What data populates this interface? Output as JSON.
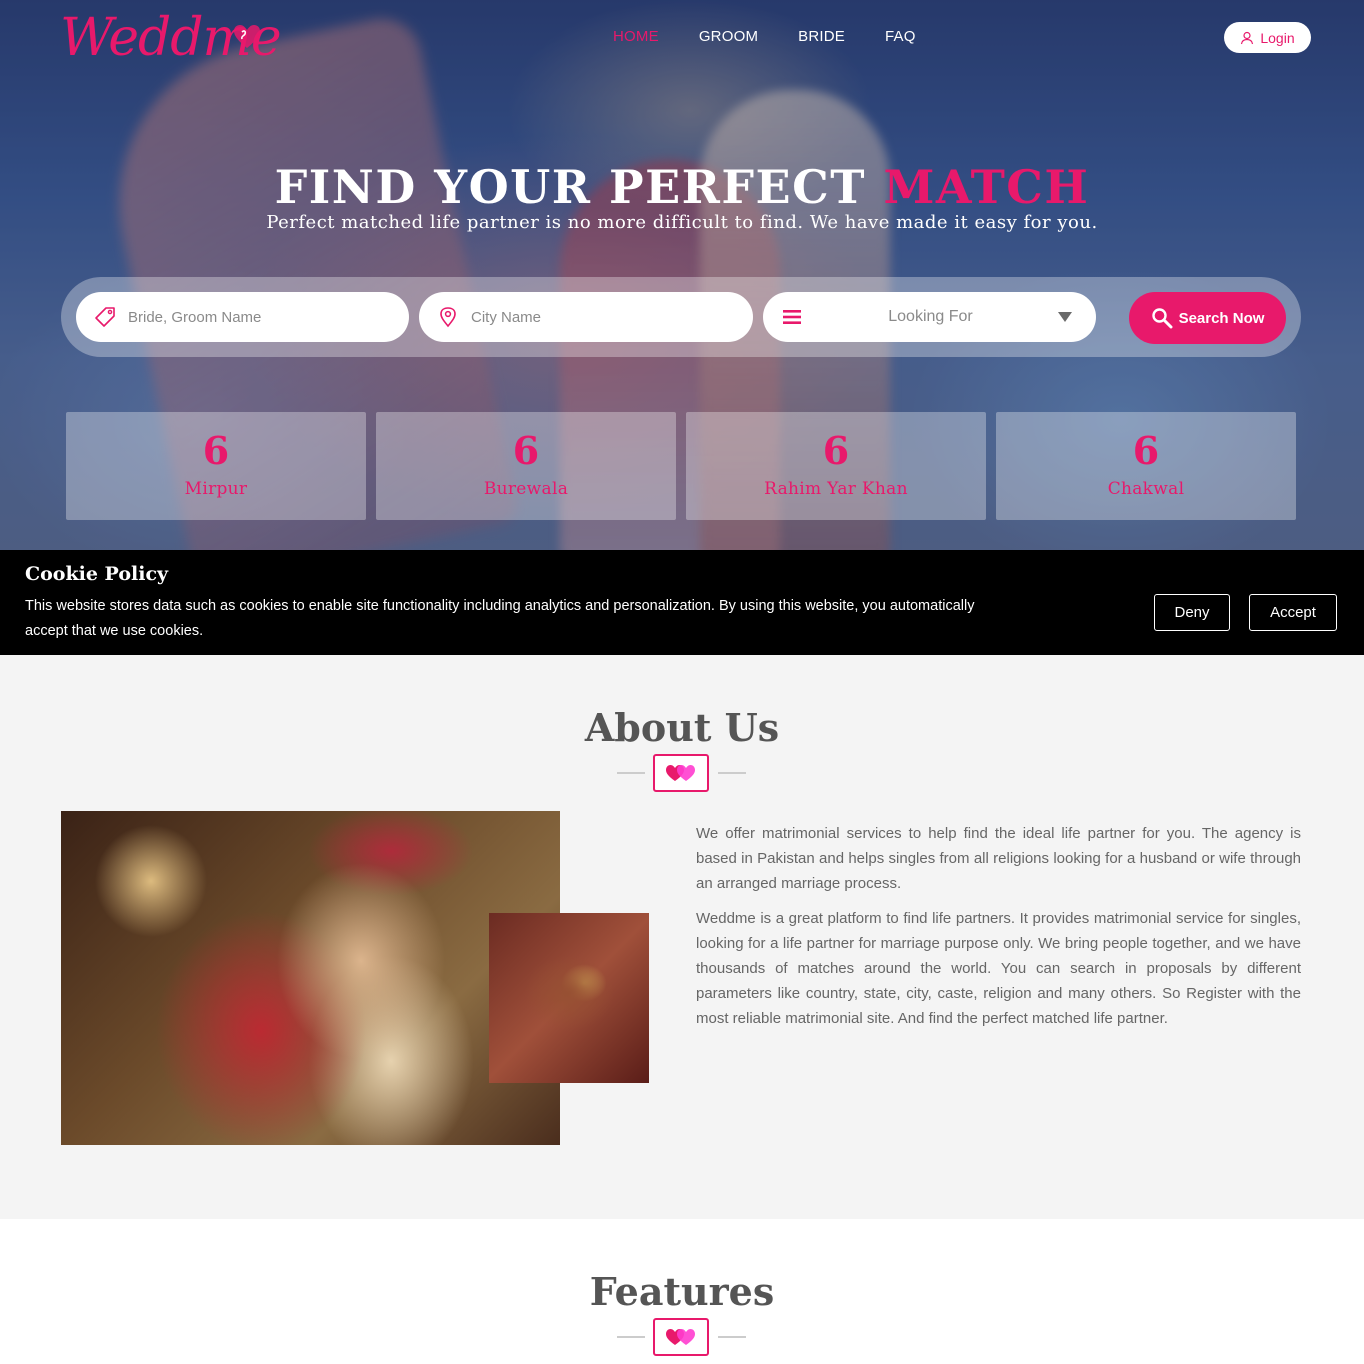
{
  "brand": {
    "logo_text": "Weddme",
    "accent_color": "#e8196b"
  },
  "nav": {
    "items": [
      {
        "label": "HOME",
        "active": true
      },
      {
        "label": "GROOM",
        "active": false
      },
      {
        "label": "BRIDE",
        "active": false
      },
      {
        "label": "FAQ",
        "active": false
      }
    ],
    "login_label": "Login",
    "login_icon": "user-icon"
  },
  "hero": {
    "title_main": "FIND YOUR PERFECT ",
    "title_accent": "MATCH",
    "subtitle": "Perfect matched life partner is no more difficult to find. We have made it easy for you."
  },
  "search": {
    "name_placeholder": "Bride, Groom Name",
    "name_icon": "tag-icon",
    "city_placeholder": "City Name",
    "city_icon": "location-pin-icon",
    "looking_for_label": "Looking For",
    "looking_for_icon": "menu-icon",
    "button_label": "Search Now",
    "button_icon": "search-icon"
  },
  "stats": [
    {
      "count": "6",
      "city": "Mirpur"
    },
    {
      "count": "6",
      "city": "Burewala"
    },
    {
      "count": "6",
      "city": "Rahim Yar Khan"
    },
    {
      "count": "6",
      "city": "Chakwal"
    }
  ],
  "cookie": {
    "title": "Cookie Policy",
    "text": "This website stores data such as cookies to enable site functionality including analytics and personalization. By using this website, you automatically accept that we use cookies.",
    "deny_label": "Deny",
    "accept_label": "Accept"
  },
  "about": {
    "title": "About Us",
    "divider_icon": "hearts-icon",
    "paragraphs": [
      "We offer matrimonial services to help find the ideal life partner for you. The agency is based in Pakistan and helps singles from all religions looking for a husband or wife through an arranged marriage process.",
      "Weddme is a great platform to find life partners. It provides matrimonial service for singles, looking for a life partner for marriage purpose only. We bring people together, and we have thousands of matches around the world. You can search in proposals by different parameters like country, state, city, caste, religion and many others. So Register with the most reliable matrimonial site. And find the perfect matched life partner."
    ]
  },
  "features": {
    "title": "Features",
    "divider_icon": "hearts-icon"
  }
}
